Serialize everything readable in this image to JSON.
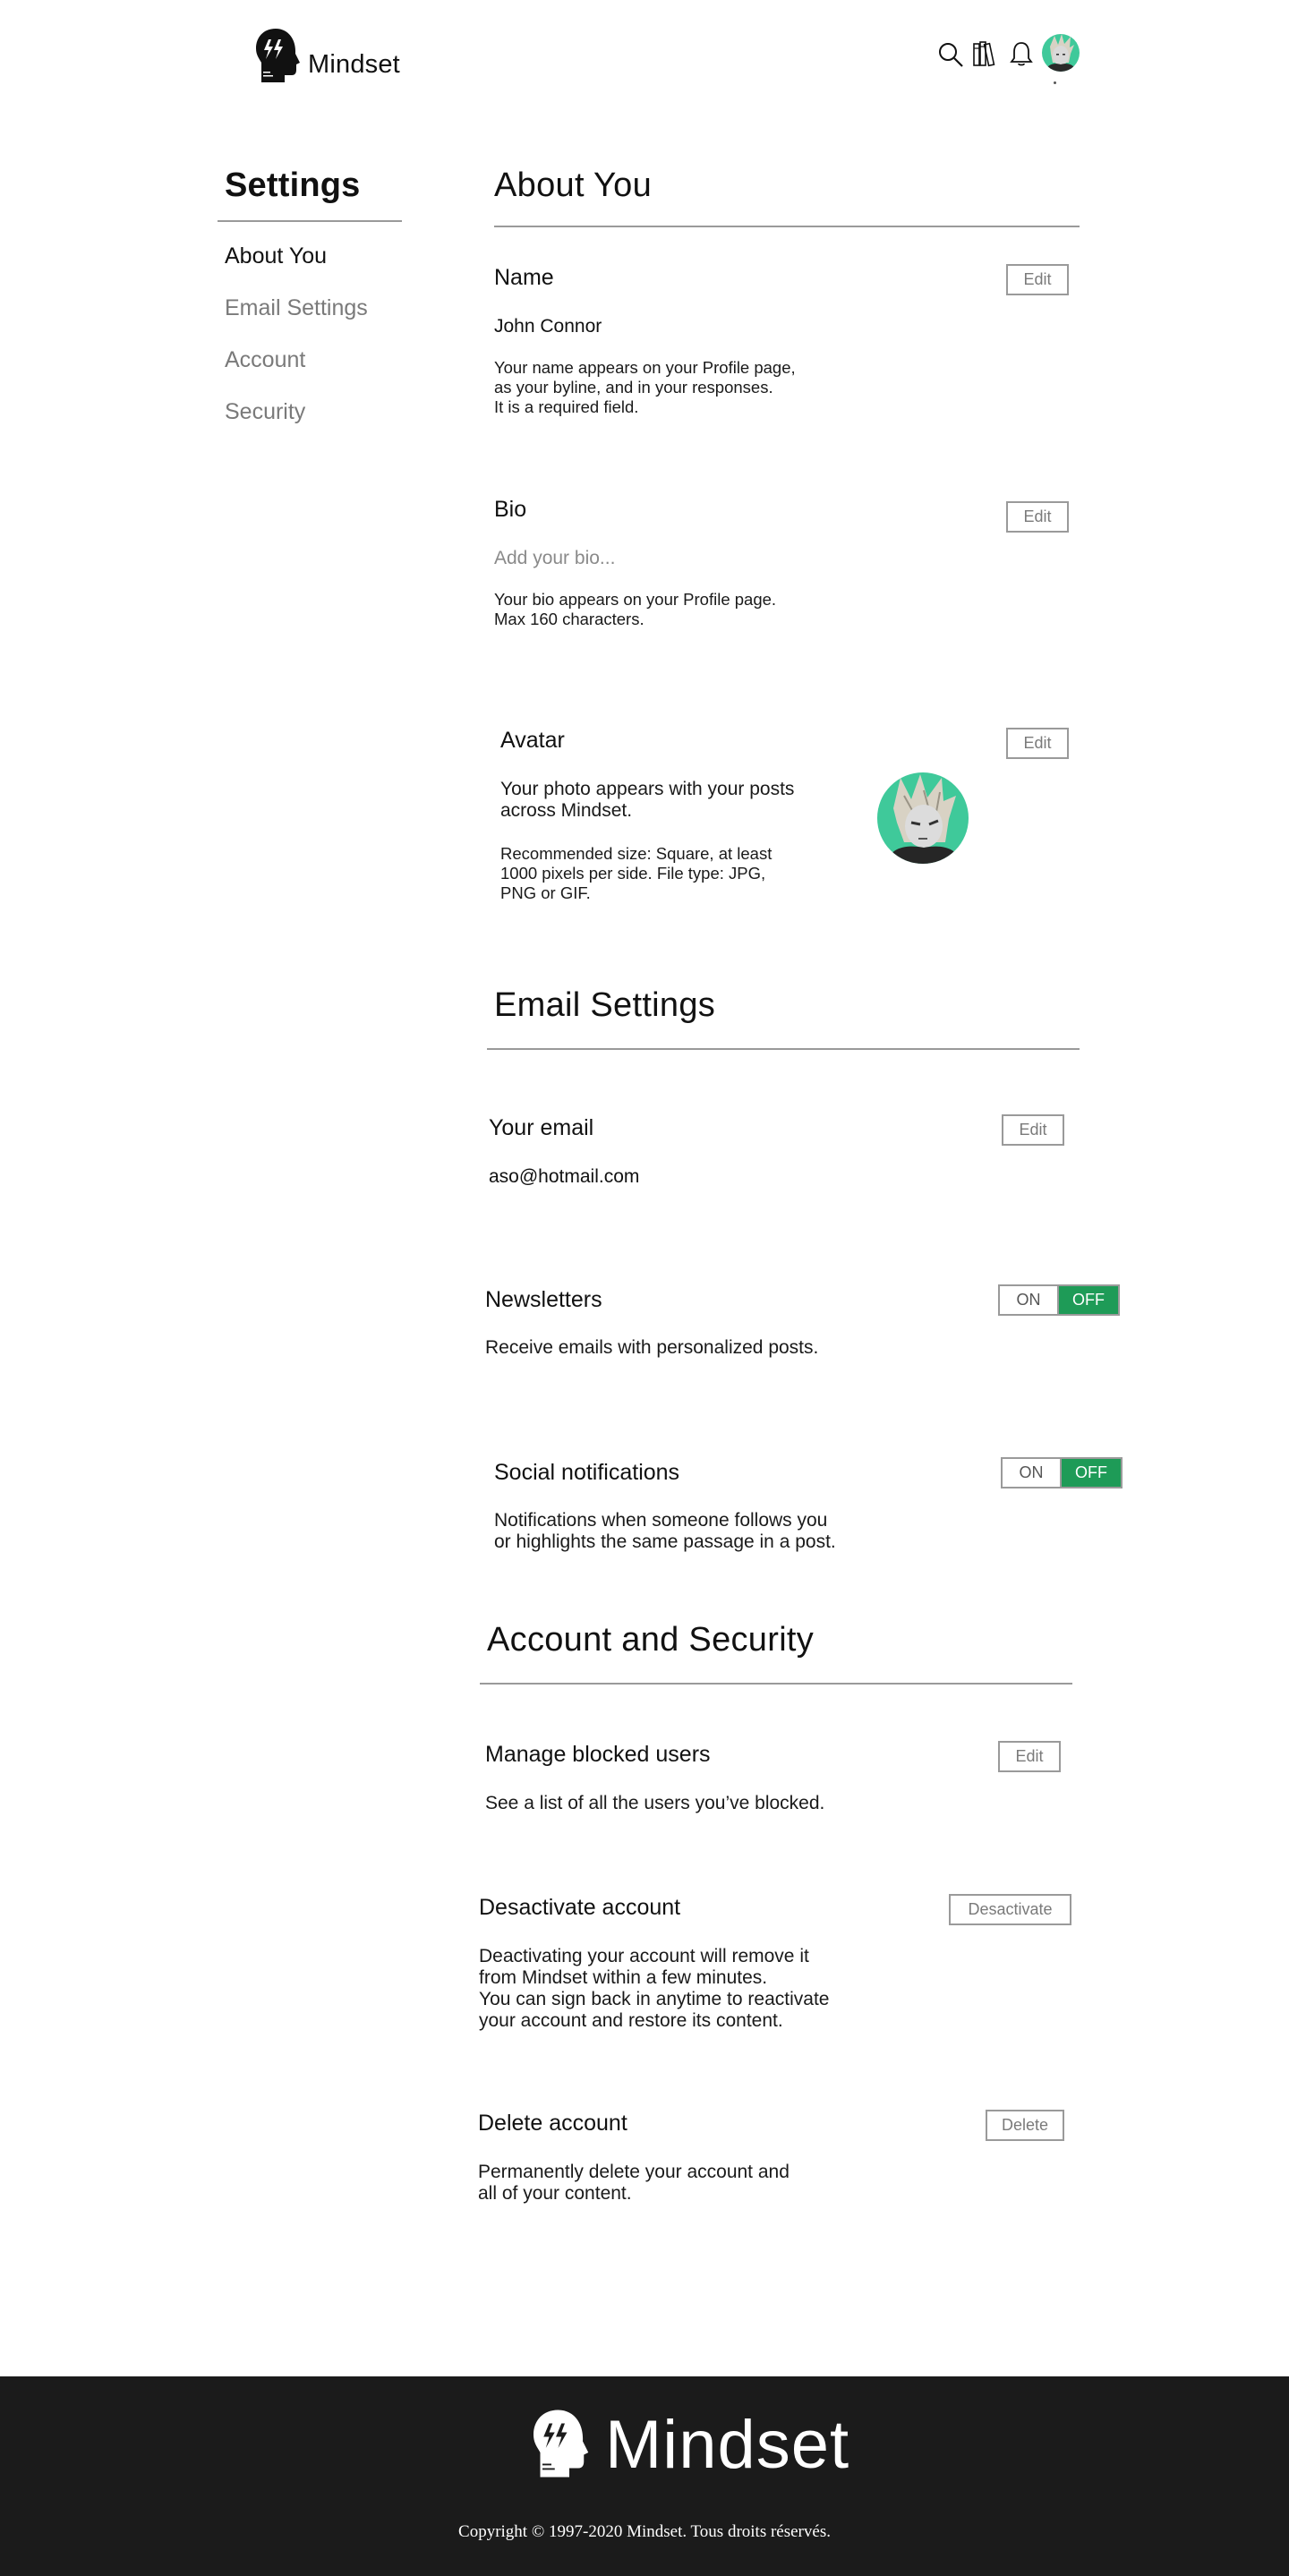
{
  "brand": {
    "name": "Mindset"
  },
  "header": {
    "icons": [
      "search-icon",
      "library-icon",
      "bell-icon"
    ],
    "avatar": "user-avatar"
  },
  "sidebar": {
    "title": "Settings",
    "items": [
      {
        "label": "About You",
        "active": true
      },
      {
        "label": "Email Settings",
        "active": false
      },
      {
        "label": "Account",
        "active": false
      },
      {
        "label": "Security",
        "active": false
      }
    ]
  },
  "about": {
    "title": "About You",
    "name": {
      "title": "Name",
      "edit": "Edit",
      "value": "John Connor",
      "desc": [
        "Your name appears on your Profile page,",
        "as your byline, and in your responses.",
        "It is a required field."
      ]
    },
    "bio": {
      "title": "Bio",
      "edit": "Edit",
      "placeholder": "Add your bio...",
      "desc": [
        "Your bio appears on your Profile page.",
        "Max 160 characters."
      ]
    },
    "avatar": {
      "title": "Avatar",
      "edit": "Edit",
      "desc1": [
        "Your photo appears with your posts",
        "across Mindset."
      ],
      "desc2": [
        "Recommended size: Square, at least",
        "1000 pixels per side. File type: JPG,",
        "PNG or GIF."
      ]
    }
  },
  "email": {
    "title": "Email Settings",
    "your_email": {
      "title": "Your email",
      "edit": "Edit",
      "value": "aso@hotmail.com"
    },
    "newsletters": {
      "title": "Newsletters",
      "on": "ON",
      "off": "OFF",
      "state": "OFF",
      "desc": "Receive emails with personalized posts."
    },
    "social": {
      "title": "Social notifications",
      "on": "ON",
      "off": "OFF",
      "state": "OFF",
      "desc": [
        "Notifications when someone follows you",
        "or highlights the same passage in a post."
      ]
    }
  },
  "account": {
    "title": "Account and Security",
    "blocked": {
      "title": "Manage blocked users",
      "edit": "Edit",
      "desc": "See a list of all the users you’ve blocked."
    },
    "deactivate": {
      "title": "Desactivate account",
      "button": "Desactivate",
      "desc": [
        "Deactivating your account will remove it",
        "from Mindset within a few minutes.",
        "You can sign back in anytime to reactivate",
        "your account and restore its content."
      ]
    },
    "delete": {
      "title": "Delete account",
      "button": "Delete",
      "desc": [
        "Permanently delete your account and",
        "all of your content."
      ]
    }
  },
  "footer": {
    "brand": "Mindset",
    "copyright": "Copyright © 1997-2020 Mindset. Tous droits réservés."
  },
  "colors": {
    "accent": "#1e9b57",
    "footer_bg": "#1b1b1b",
    "muted": "#7a7a7a",
    "rule": "#9a9a9a"
  }
}
